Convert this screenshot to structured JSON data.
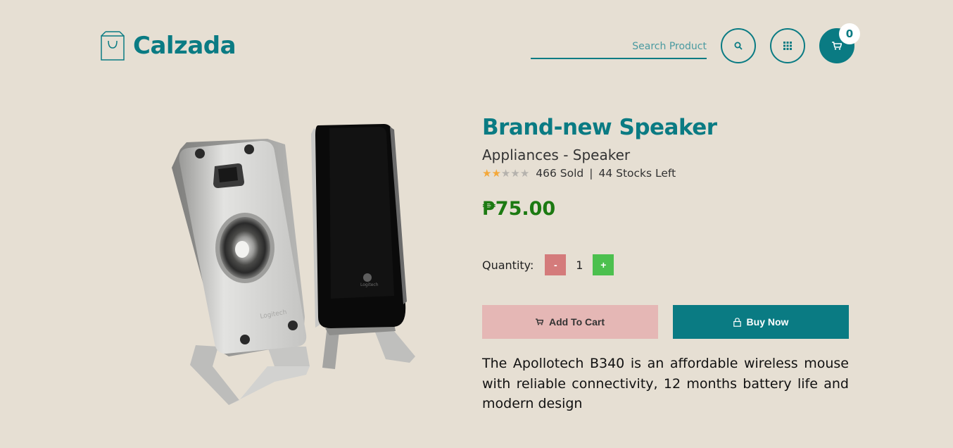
{
  "header": {
    "logo_text": "Calzada",
    "search_placeholder": "Search Product",
    "cart_count": "0"
  },
  "product": {
    "title": "Brand-new Speaker",
    "category": "Appliances - Speaker",
    "rating": 2,
    "rating_max": 5,
    "sold": "466 Sold",
    "separator": "|",
    "stock": "44 Stocks Left",
    "price": "₱75.00",
    "quantity_label": "Quantity:",
    "quantity_minus": "-",
    "quantity_value": "1",
    "quantity_plus": "+",
    "add_to_cart_label": "Add To Cart",
    "buy_now_label": "Buy Now",
    "description": "The Apollotech B340 is an affordable wireless mouse with reliable connectivity, 12 months battery life and modern design"
  },
  "colors": {
    "background": "#e6dfd3",
    "primary": "#0a7b83",
    "price": "#1c7a12",
    "minus": "#d47b7b",
    "plus": "#4cc04e",
    "add_to_cart_bg": "#e5b7b5",
    "star_on": "#f4a83a"
  },
  "icons": {
    "logo": "shopping-bag-icon",
    "search": "search-icon",
    "apps": "grid-icon",
    "cart": "cart-icon",
    "buy": "lock-icon"
  }
}
